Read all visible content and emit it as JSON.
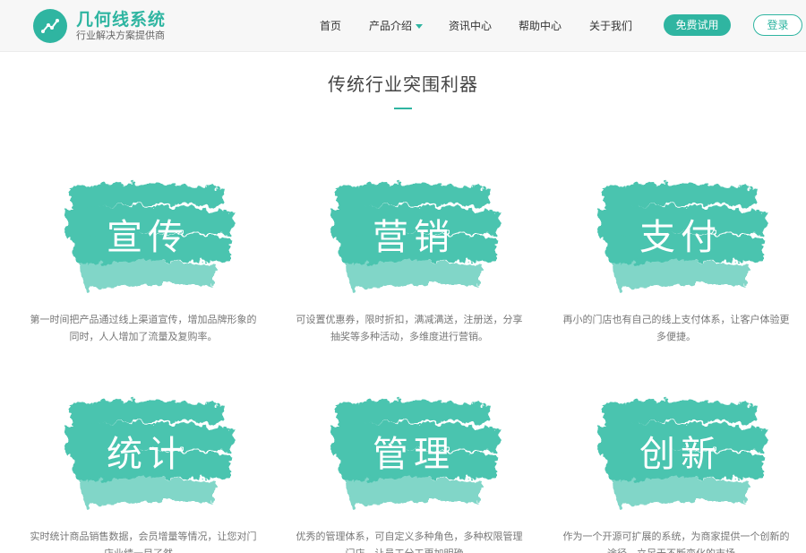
{
  "brand": {
    "title": "几何线系统",
    "subtitle": "行业解决方案提供商",
    "accent_color": "#2fb5a1",
    "logo_icon": "trend-line-icon"
  },
  "nav": {
    "items": [
      {
        "label": "首页"
      },
      {
        "label": "产品介绍"
      },
      {
        "label": "资讯中心"
      },
      {
        "label": "帮助中心"
      },
      {
        "label": "关于我们"
      }
    ],
    "trial_label": "免费试用",
    "login_label": "登录"
  },
  "section": {
    "title": "传统行业突围利器"
  },
  "features": [
    {
      "label": "宣传",
      "desc": "第一时间把产品通过线上渠道宣传，增加品牌形象的同时，人人增加了流量及复购率。"
    },
    {
      "label": "营销",
      "desc": "可设置优惠券，限时折扣，满减满送，注册送，分享抽奖等多种活动，多维度进行营销。"
    },
    {
      "label": "支付",
      "desc": "再小的门店也有自己的线上支付体系，让客户体验更多便捷。"
    },
    {
      "label": "统计",
      "desc": "实时统计商品销售数据，会员增量等情况，让您对门店业绩一目了然。"
    },
    {
      "label": "管理",
      "desc": "优秀的管理体系，可自定义多种角色，多种权限管理门店，让员工分工更加明确。"
    },
    {
      "label": "创新",
      "desc": "作为一个开源可扩展的系统，为商家提供一个创新的途径，立足于不断变化的市场。"
    }
  ]
}
